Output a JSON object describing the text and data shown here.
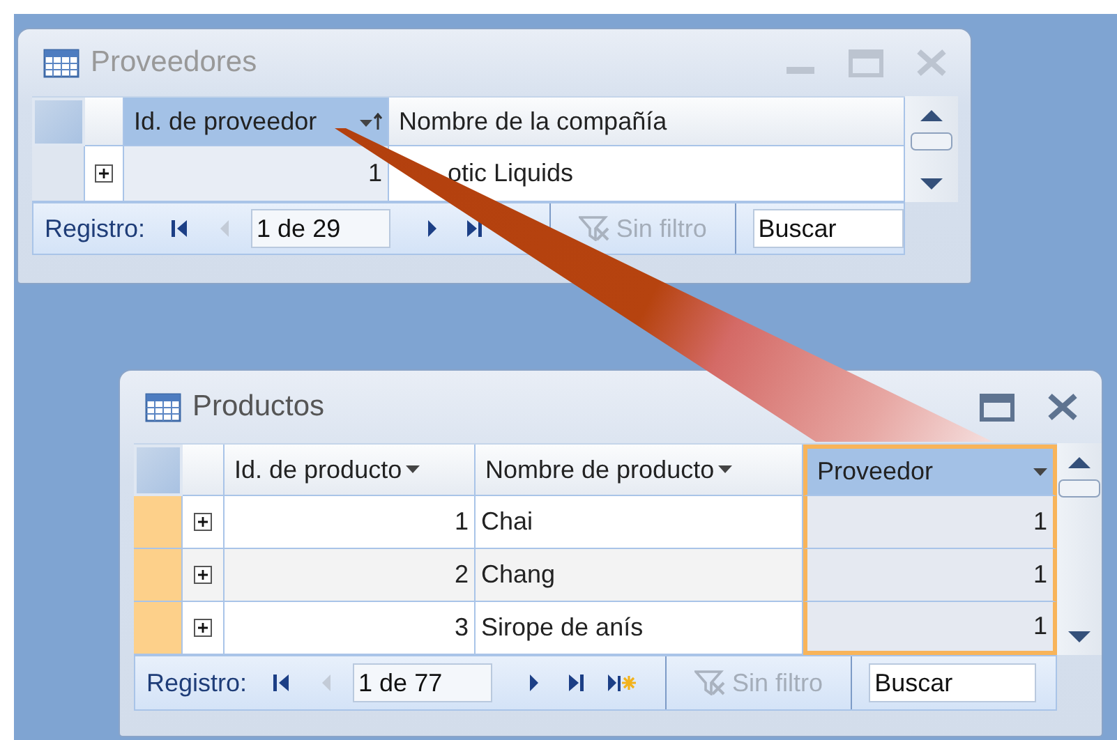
{
  "windows": [
    {
      "title": "Proveedores",
      "active": false,
      "controls": [
        {
          "kind": "minimize"
        },
        {
          "kind": "maximize"
        },
        {
          "kind": "close"
        }
      ],
      "columns": [
        {
          "label": "Id. de proveedor",
          "selected": true,
          "menu": true,
          "sorted": true
        },
        {
          "label": "Nombre de la compañía",
          "selected": false,
          "menu": false,
          "sorted": false
        }
      ],
      "rows": [
        {
          "highlighted": false,
          "cells": [
            "1",
            "otic Liquids"
          ]
        }
      ],
      "nav": {
        "label": "Registro:",
        "position": "1 de 29",
        "buttons": [
          {
            "kind": "first",
            "disabled": false
          },
          {
            "kind": "prev",
            "disabled": true
          },
          {
            "kind": "next",
            "disabled": false
          },
          {
            "kind": "last",
            "disabled": false
          }
        ],
        "filter": {
          "label": "Sin filtro",
          "active": false
        },
        "search": {
          "placeholder": "Buscar"
        }
      }
    },
    {
      "title": "Productos",
      "active": true,
      "controls": [
        {
          "kind": "maximize"
        },
        {
          "kind": "close"
        }
      ],
      "columns": [
        {
          "label": "Id. de producto",
          "selected": false,
          "menu": true,
          "sorted": false
        },
        {
          "label": "Nombre de producto",
          "selected": false,
          "menu": true,
          "sorted": false
        },
        {
          "label": "Proveedor",
          "selected": true,
          "menu": true,
          "sorted": false
        }
      ],
      "rows": [
        {
          "highlighted": true,
          "cells": [
            "1",
            "Chai",
            "1"
          ]
        },
        {
          "highlighted": true,
          "cells": [
            "2",
            "Chang",
            "1"
          ]
        },
        {
          "highlighted": true,
          "cells": [
            "3",
            "Sirope de anís",
            "1"
          ]
        }
      ],
      "nav": {
        "label": "Registro:",
        "position": "1 de 77",
        "buttons": [
          {
            "kind": "first",
            "disabled": false
          },
          {
            "kind": "prev",
            "disabled": true
          },
          {
            "kind": "next",
            "disabled": false
          },
          {
            "kind": "last",
            "disabled": false
          },
          {
            "kind": "new",
            "disabled": false
          }
        ],
        "filter": {
          "label": "Sin filtro",
          "active": false
        },
        "search": {
          "placeholder": "Buscar"
        }
      }
    }
  ]
}
